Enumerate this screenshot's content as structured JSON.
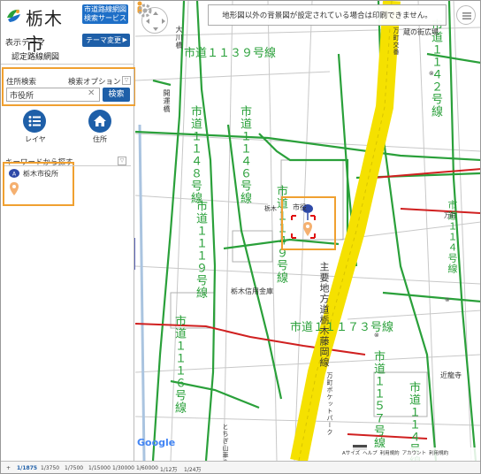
{
  "app": {
    "logo_text": "栃木市",
    "service_name_line1": "市道路線網図",
    "service_name_line2": "検索サービス"
  },
  "sidebar": {
    "theme_label": "表示テーマ",
    "theme_change_label": "テーマ変更",
    "theme_name": "認定路線網図",
    "address_search_label": "住所検索",
    "search_options_label": "検索オプション",
    "address_input_value": "市役所",
    "search_button_label": "検索",
    "layer_label": "レイヤ",
    "home_label": "住所",
    "keyword_search_label": "キーワードから探す",
    "result_text": "栃木市役所"
  },
  "map": {
    "notice": "地形図以外の背景図が設定されている場合は印刷できません。",
    "google_label": "Google",
    "attribution": [
      "Aサイズ",
      "ヘルプ",
      "利用規約",
      "アカウント",
      "利用規約"
    ],
    "labels": [
      "市道１１３９号線",
      "市道１１４２号線",
      "市道１１４８号線",
      "市道１１４６号線",
      "市道１１４９号線",
      "市道１１１９号線",
      "市道１１１６号線",
      "市道１１４号線",
      "市道１１１７３号線",
      "主要地方道栃木藤岡線",
      "市道１１５７号線",
      "市道１１４号線",
      "大川橋",
      "開運橋",
      "栃木信用金庫",
      "近龍寺",
      "蔵の街広場",
      "市役",
      "万町交番",
      "万町ポケットパーク",
      "とちぎ山車会館",
      "栃木",
      "万町"
    ]
  },
  "scalebar": [
    "1/1875",
    "1/3750",
    "1/7500",
    "1/15000",
    "1/30000",
    "1/60000",
    "1/12万",
    "1/24万"
  ],
  "colors": {
    "road_green": "#2aa03a",
    "road_red": "#d02020",
    "highway_yellow": "#f5e100",
    "brand_blue": "#1e5fa8",
    "highlight_orange": "#f0a030"
  }
}
